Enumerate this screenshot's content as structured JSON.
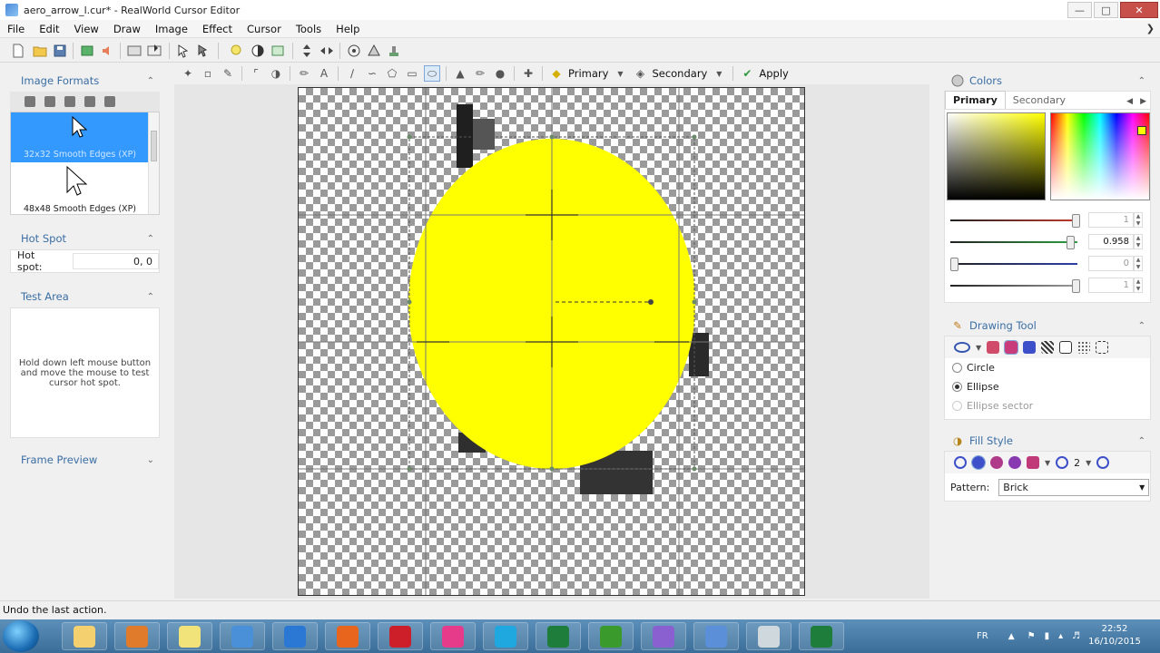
{
  "window": {
    "title": "aero_arrow_l.cur* - RealWorld Cursor Editor"
  },
  "menu": [
    "File",
    "Edit",
    "View",
    "Draw",
    "Image",
    "Effect",
    "Cursor",
    "Tools",
    "Help"
  ],
  "toolbar2": {
    "primary_label": "Primary",
    "secondary_label": "Secondary",
    "apply_label": "Apply"
  },
  "left": {
    "image_formats": {
      "title": "Image Formats",
      "items": [
        "32x32 Smooth Edges (XP)",
        "48x48 Smooth Edges (XP)"
      ]
    },
    "hot_spot": {
      "title": "Hot Spot",
      "label": "Hot spot:",
      "value": "0, 0"
    },
    "test_area": {
      "title": "Test Area",
      "hint": "Hold down left mouse button and move the mouse to test cursor hot spot."
    },
    "frame_preview": {
      "title": "Frame Preview"
    }
  },
  "right": {
    "colors": {
      "title": "Colors",
      "tabs": [
        "Primary",
        "Secondary"
      ],
      "sliders": [
        {
          "value": "1",
          "level": 1.0,
          "color": "#c0392b"
        },
        {
          "value": "0.958",
          "level": 0.958,
          "color": "#2e9e3e"
        },
        {
          "value": "0",
          "level": 0.0,
          "color": "#2d3fa8"
        },
        {
          "value": "1",
          "level": 1.0,
          "color": "#9a9a9a"
        }
      ]
    },
    "drawing_tool": {
      "title": "Drawing Tool",
      "options": [
        "Circle",
        "Ellipse",
        "Ellipse sector"
      ],
      "selected": "Ellipse"
    },
    "fill_style": {
      "title": "Fill Style",
      "width_value": "2",
      "pattern_label": "Pattern:",
      "pattern_value": "Brick"
    }
  },
  "status": {
    "text": "Undo the last action."
  },
  "taskbar": {
    "language": "FR",
    "time": "22:52",
    "date": "16/10/2015",
    "apps": [
      "explorer",
      "media-player",
      "sticky-notes",
      "chrome",
      "internet-explorer",
      "firefox",
      "opera",
      "paint",
      "skype",
      "camtasia",
      "utorrent",
      "tool",
      "remote-desktop",
      "pen-tablet",
      "camtasia-2"
    ]
  },
  "colors": {
    "accent": "#3399ff",
    "title_blue": "#3a6ea5",
    "fill_yellow": "#ffff00"
  }
}
